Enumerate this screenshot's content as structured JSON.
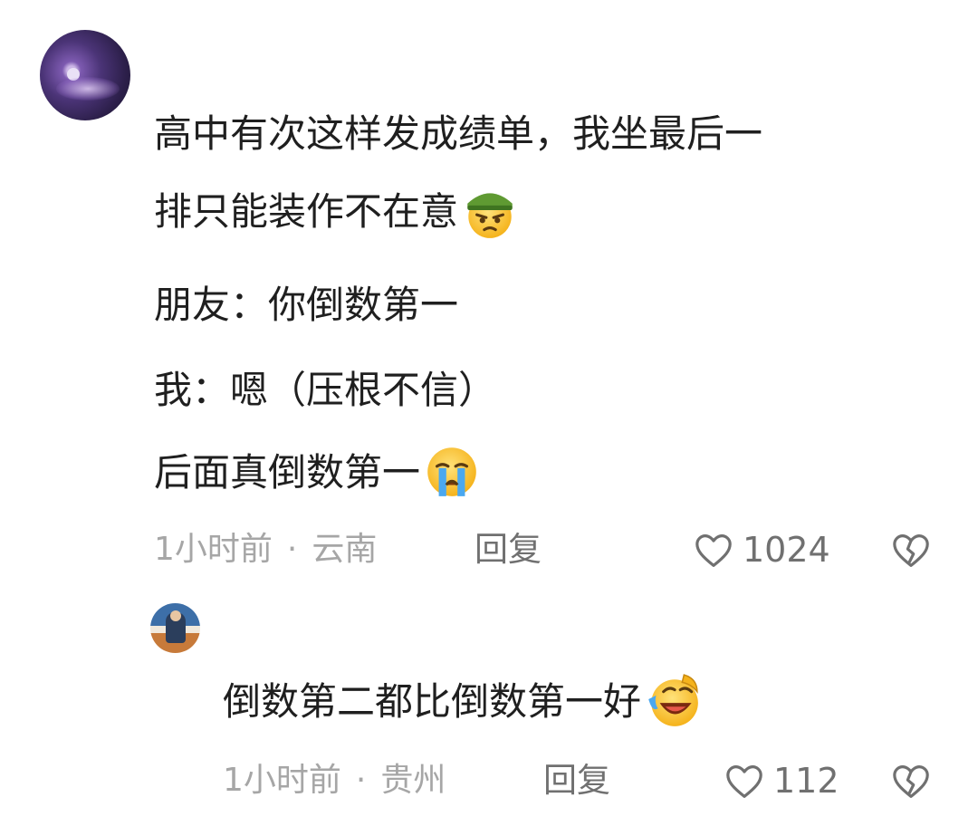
{
  "comment": {
    "lines": [
      "高中有次这样发成绩单，我坐最后一",
      "排只能装作不在意",
      "朋友：你倒数第一",
      "我：嗯（压根不信）",
      "后面真倒数第一"
    ],
    "emoji_line2": "angry-soldier-emoji",
    "emoji_line5": "loudly-crying-emoji",
    "time": "1小时前",
    "separator": "·",
    "location": "云南",
    "reply_label": "回复",
    "like_count": "1024"
  },
  "reply": {
    "text": "倒数第二都比倒数第一好",
    "emoji": "laughing-crying-emoji",
    "time": "1小时前",
    "separator": "·",
    "location": "贵州",
    "reply_label": "回复",
    "like_count": "112"
  },
  "icons": {
    "like": "heart-outline-icon",
    "dislike": "broken-heart-icon"
  }
}
